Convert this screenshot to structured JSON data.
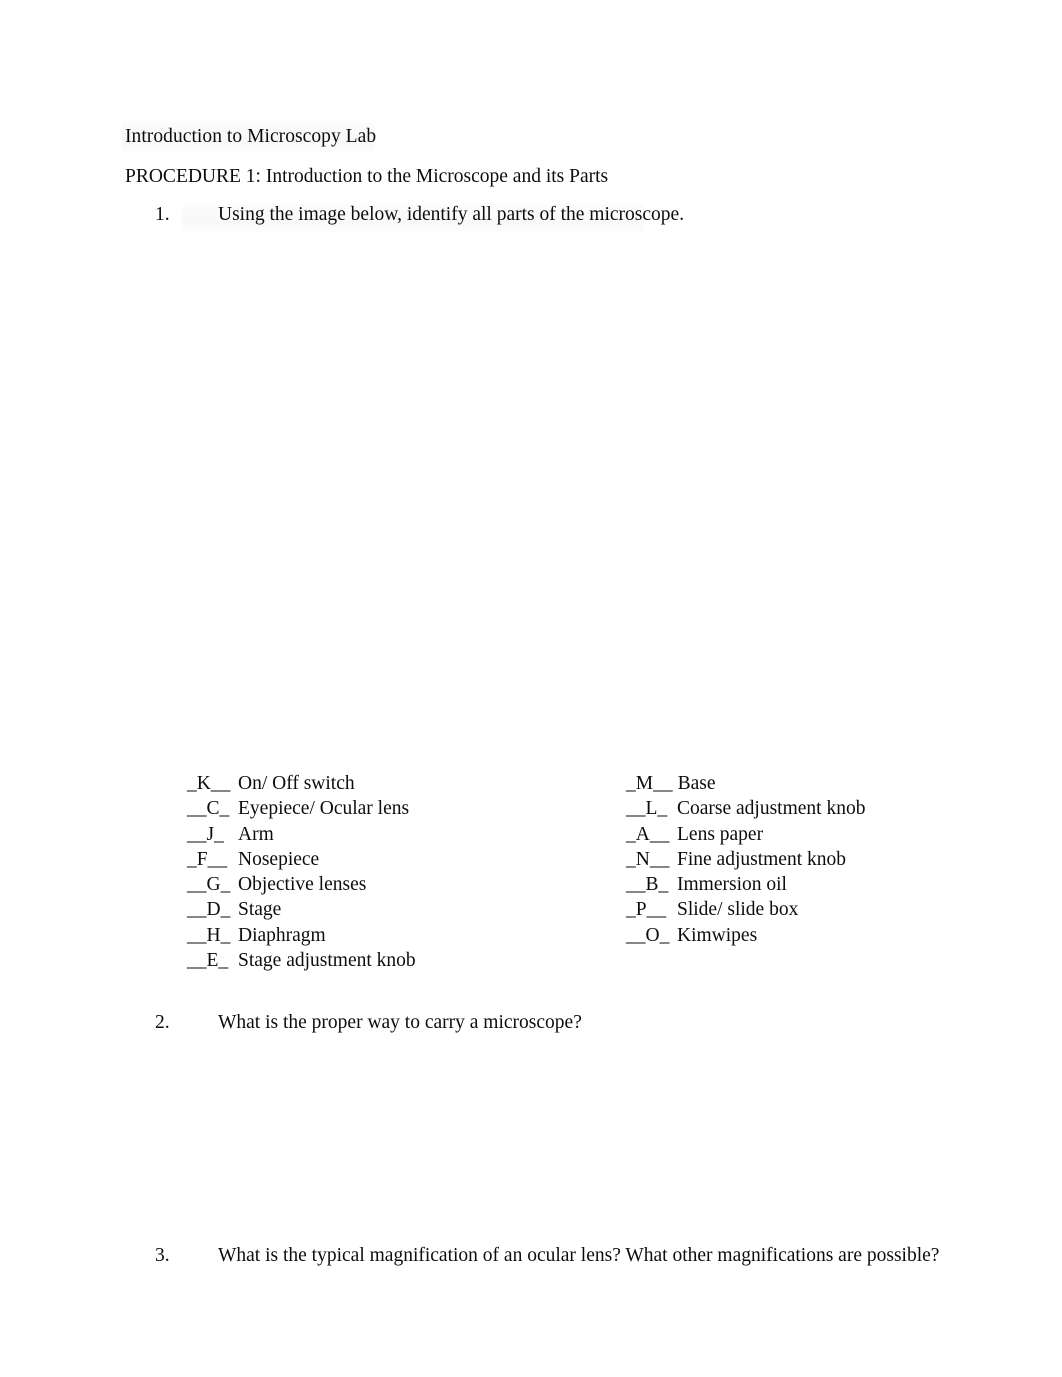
{
  "document": {
    "title": "Introduction to Microscopy Lab",
    "procedure_heading": "PROCEDURE 1: Introduction to the Microscope and its Parts"
  },
  "questions": [
    {
      "number": "1.",
      "text": "Using the image below, identify all parts of the microscope."
    },
    {
      "number": "2.",
      "text": "What is the proper way to carry a microscope?"
    },
    {
      "number": "3.",
      "text": "What is the typical magnification of an ocular lens? What other magnifications are possible?"
    }
  ],
  "answer_list": {
    "left_column": [
      {
        "blank": "_K__",
        "label": "On/ Off switch"
      },
      {
        "blank": "__C_",
        "label": "Eyepiece/ Ocular lens"
      },
      {
        "blank": "__J_",
        "label": "Arm"
      },
      {
        "blank": "_F__",
        "label": "Nosepiece"
      },
      {
        "blank": "__G_",
        "label": "Objective lenses"
      },
      {
        "blank": "__D_",
        "label": "Stage"
      },
      {
        "blank": "__H_",
        "label": "Diaphragm"
      },
      {
        "blank": "__E_",
        "label": "Stage adjustment knob"
      }
    ],
    "right_column": [
      {
        "blank": "_M__",
        "label": "Base"
      },
      {
        "blank": "__L_",
        "label": "Coarse adjustment knob"
      },
      {
        "blank": "_A__",
        "label": "Lens paper"
      },
      {
        "blank": "_N__",
        "label": "Fine adjustment knob"
      },
      {
        "blank": "__B_",
        "label": "Immersion oil"
      },
      {
        "blank": "_P__",
        "label": "Slide/ slide box"
      },
      {
        "blank": "__O_",
        "label": "Kimwipes"
      }
    ]
  },
  "colors": {
    "page_background": "#ffffff",
    "text": "#0d0d0d"
  }
}
